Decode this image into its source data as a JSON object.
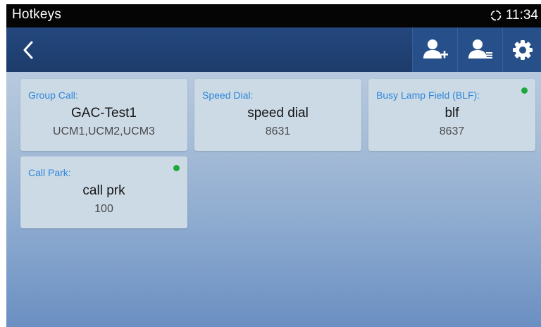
{
  "statusbar": {
    "title": "Hotkeys",
    "time": "11:34"
  },
  "actionbar": {
    "buttons": [
      "back-icon",
      "add-contact-icon",
      "contact-list-icon",
      "settings-icon"
    ]
  },
  "hotkeys": [
    {
      "type": "Group Call:",
      "name": "GAC-Test1",
      "number": "UCM1,UCM2,UCM3",
      "status_dot": false
    },
    {
      "type": "Speed Dial:",
      "name": "speed dial",
      "number": "8631",
      "status_dot": false
    },
    {
      "type": "Busy Lamp Field (BLF):",
      "name": "blf",
      "number": "8637",
      "status_dot": true,
      "status_color": "#1fa93a"
    },
    {
      "type": "Call Park:",
      "name": "call prk",
      "number": "100",
      "status_dot": true,
      "status_color": "#1fa93a"
    }
  ],
  "colors": {
    "accent": "#2d86d8",
    "actionbar": "#1d3c6c",
    "status_green": "#1fa93a"
  }
}
